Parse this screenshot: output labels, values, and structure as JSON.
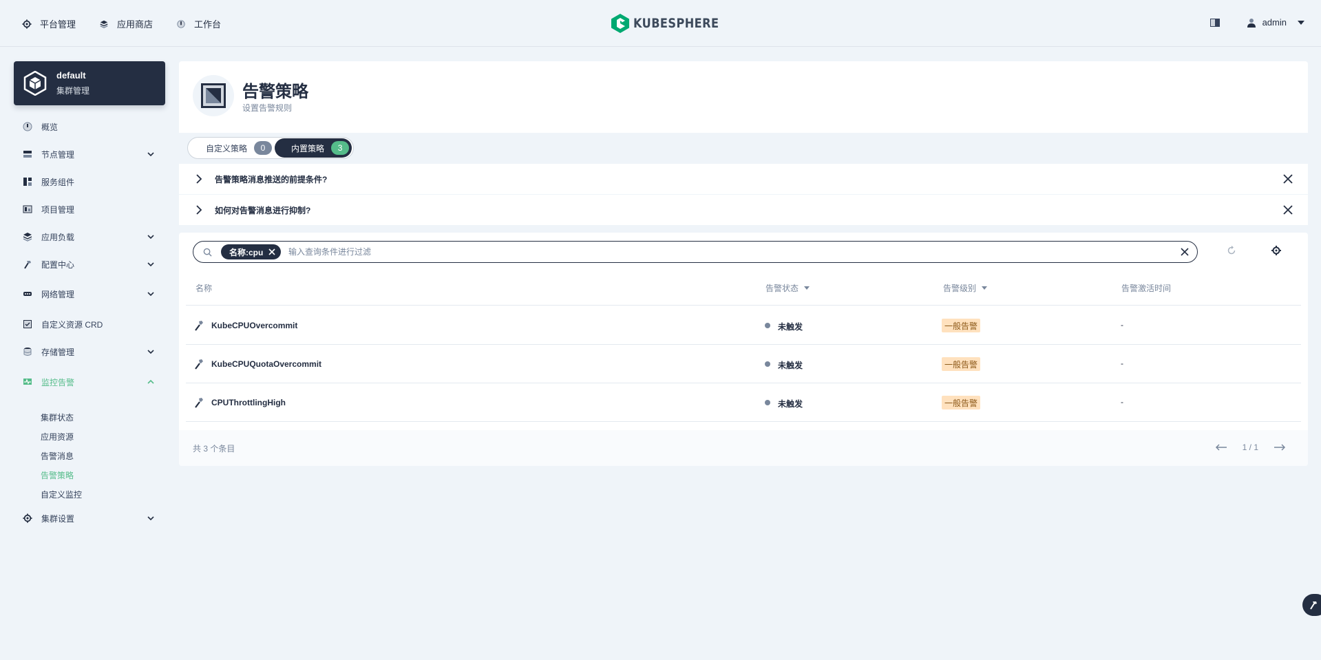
{
  "topbar": {
    "nav": [
      {
        "label": "平台管理",
        "icon": "gear-icon"
      },
      {
        "label": "应用商店",
        "icon": "app-store-icon"
      },
      {
        "label": "工作台",
        "icon": "workbench-icon"
      }
    ],
    "logo_text": "KUBESPHERE",
    "user": "admin"
  },
  "cluster": {
    "name": "default",
    "subtitle": "集群管理"
  },
  "sidebar": {
    "items": [
      {
        "label": "概览",
        "icon": "dashboard-icon",
        "expandable": false
      },
      {
        "label": "节点管理",
        "icon": "nodes-icon",
        "expandable": true
      },
      {
        "label": "服务组件",
        "icon": "components-icon",
        "expandable": false
      },
      {
        "label": "项目管理",
        "icon": "project-icon",
        "expandable": false
      },
      {
        "label": "应用负载",
        "icon": "workload-icon",
        "expandable": true
      },
      {
        "label": "配置中心",
        "icon": "hammer-icon",
        "expandable": true
      },
      {
        "label": "网络管理",
        "icon": "network-icon",
        "expandable": true
      },
      {
        "label": "自定义资源 CRD",
        "icon": "crd-icon",
        "expandable": false
      },
      {
        "label": "存储管理",
        "icon": "storage-icon",
        "expandable": true
      },
      {
        "label": "监控告警",
        "icon": "monitor-icon",
        "expandable": true,
        "expanded": true
      },
      {
        "label": "集群设置",
        "icon": "gear-icon",
        "expandable": true
      }
    ],
    "monitor_children": [
      "集群状态",
      "应用资源",
      "告警消息",
      "告警策略",
      "自定义监控"
    ],
    "active_child": "告警策略"
  },
  "page": {
    "title": "告警策略",
    "description": "设置告警规则"
  },
  "tabs": [
    {
      "label": "自定义策略",
      "count": "0"
    },
    {
      "label": "内置策略",
      "count": "3"
    }
  ],
  "faq": [
    "告警策略消息推送的前提条件?",
    "如何对告警消息进行抑制?"
  ],
  "search": {
    "tag": "名称:cpu",
    "placeholder": "输入查询条件进行过滤"
  },
  "table": {
    "columns": [
      "名称",
      "告警状态",
      "告警级别",
      "告警激活时间"
    ],
    "rows": [
      {
        "name": "KubeCPUOvercommit",
        "status": "未触发",
        "severity": "一般告警",
        "activated": "-"
      },
      {
        "name": "KubeCPUQuotaOvercommit",
        "status": "未触发",
        "severity": "一般告警",
        "activated": "-"
      },
      {
        "name": "CPUThrottlingHigh",
        "status": "未触发",
        "severity": "一般告警",
        "activated": "-"
      }
    ]
  },
  "footer": {
    "total": "共 3 个条目",
    "page": "1 / 1"
  },
  "colors": {
    "accent": "#55bc8a",
    "dark": "#242e42",
    "warning_bg": "#ffe1be"
  }
}
